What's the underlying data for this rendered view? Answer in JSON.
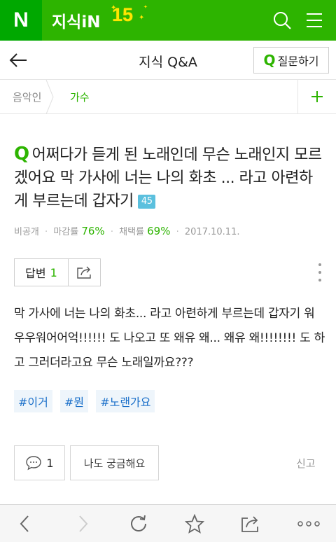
{
  "topbar": {
    "logo": "N",
    "brand": "지식iN",
    "anniversary": "15",
    "colors": {
      "green": "#2db400",
      "dark_green": "#00a800",
      "accent_yellow": "#ffe600"
    },
    "icons": [
      "search-icon",
      "menu-icon"
    ]
  },
  "header": {
    "title": "지식 Q&A",
    "ask_button_q": "Q",
    "ask_button_label": "질문하기"
  },
  "category": {
    "parent": "음악인",
    "current": "가수",
    "add_icon": "plus-icon"
  },
  "question": {
    "q_mark": "Q",
    "title": "어쩌다가 듣게 된 노래인데 무슨 노래인지 모르겠어요 막 가사에 너는 나의 화초 ... 라고 아련하게 부르는데 갑자기",
    "extra_count": "45"
  },
  "meta": {
    "author": "비공개",
    "close_rate_label": "마감률",
    "close_rate": "76%",
    "adopt_rate_label": "채택률",
    "adopt_rate": "69%",
    "date": "2017.10.11."
  },
  "answers": {
    "label": "답변",
    "count": "1"
  },
  "body": "막 가사에 너는 나의 화초... 라고 아련하게 부르는데 갑자기 워우우워어어억!!!!!! 도 나오고 또 왜유 왜... 왜유 왜!!!!!!!! 도 하고 그러더라고요 무슨 노래일까요???",
  "tags": [
    "#이거",
    "#뭔",
    "#노랜가요"
  ],
  "actions": {
    "comment_count": "1",
    "curious_label": "나도 궁금해요",
    "report_label": "신고"
  },
  "browser_toolbar": [
    "back-icon",
    "forward-icon",
    "refresh-icon",
    "bookmark-star-icon",
    "share-icon",
    "more-icon"
  ]
}
